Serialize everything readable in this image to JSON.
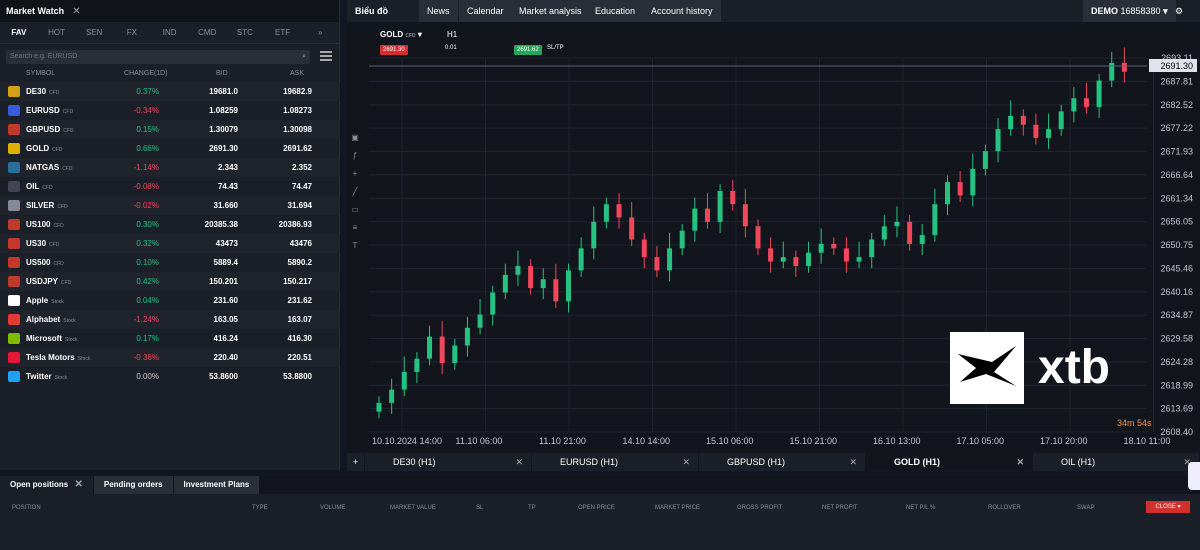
{
  "market_watch": {
    "title": "Market Watch",
    "categories": [
      "FAV",
      "HOT",
      "SEN",
      "FX",
      "IND",
      "CMD",
      "STC",
      "ETF",
      "»"
    ],
    "search_placeholder": "Search e.g. EURUSD",
    "columns": [
      "SYMBOL",
      "CHANGE(1D)",
      "BID",
      "ASK"
    ],
    "rows": [
      {
        "symbol": "DE30",
        "type": "CFD",
        "change": "0.37%",
        "bid": "19681.0",
        "ask": "19682.9",
        "dir": "pos",
        "icon": "flag-de-icon"
      },
      {
        "symbol": "EURUSD",
        "type": "CFD",
        "change": "-0.34%",
        "bid": "1.08259",
        "ask": "1.08273",
        "dir": "neg",
        "icon": "flag-eu-icon"
      },
      {
        "symbol": "GBPUSD",
        "type": "CFD",
        "change": "0.15%",
        "bid": "1.30079",
        "ask": "1.30098",
        "dir": "pos",
        "icon": "flag-gb-icon"
      },
      {
        "symbol": "GOLD",
        "type": "CFD",
        "change": "0.66%",
        "bid": "2691.30",
        "ask": "2691.62",
        "dir": "pos",
        "icon": "gold-icon"
      },
      {
        "symbol": "NATGAS",
        "type": "CFD",
        "change": "-1.14%",
        "bid": "2.343",
        "ask": "2.352",
        "dir": "neg",
        "icon": "flame-icon"
      },
      {
        "symbol": "OIL",
        "type": "CFD",
        "change": "-0.08%",
        "bid": "74.43",
        "ask": "74.47",
        "dir": "neg",
        "icon": "oil-icon"
      },
      {
        "symbol": "SILVER",
        "type": "CFD",
        "change": "-0.02%",
        "bid": "31.660",
        "ask": "31.694",
        "dir": "neg",
        "icon": "silver-icon"
      },
      {
        "symbol": "US100",
        "type": "CFD",
        "change": "0.30%",
        "bid": "20385.38",
        "ask": "20386.93",
        "dir": "pos",
        "icon": "flag-us-icon"
      },
      {
        "symbol": "US30",
        "type": "CFD",
        "change": "0.32%",
        "bid": "43473",
        "ask": "43476",
        "dir": "pos",
        "icon": "flag-us-icon"
      },
      {
        "symbol": "US500",
        "type": "CFD",
        "change": "0.10%",
        "bid": "5889.4",
        "ask": "5890.2",
        "dir": "pos",
        "icon": "flag-us-icon"
      },
      {
        "symbol": "USDJPY",
        "type": "CFD",
        "change": "0.42%",
        "bid": "150.201",
        "ask": "150.217",
        "dir": "pos",
        "icon": "flag-us-icon"
      },
      {
        "symbol": "Apple",
        "type": "Stock",
        "change": "0.04%",
        "bid": "231.60",
        "ask": "231.62",
        "dir": "pos",
        "icon": "apple-icon"
      },
      {
        "symbol": "Alphabet",
        "type": "Stock",
        "change": "-1.24%",
        "bid": "163.05",
        "ask": "163.07",
        "dir": "neg",
        "icon": "alphabet-icon"
      },
      {
        "symbol": "Microsoft",
        "type": "Stock",
        "change": "0.17%",
        "bid": "416.24",
        "ask": "416.30",
        "dir": "pos",
        "icon": "microsoft-icon"
      },
      {
        "symbol": "Tesla Motors",
        "type": "Stock",
        "change": "-0.36%",
        "bid": "220.40",
        "ask": "220.51",
        "dir": "neg",
        "icon": "tesla-icon"
      },
      {
        "symbol": "Twitter",
        "type": "Stock",
        "change": "0.00%",
        "bid": "53.8600",
        "ask": "53.8800",
        "dir": "neu",
        "icon": "twitter-icon"
      }
    ]
  },
  "top_tabs": [
    "Biểu đồ",
    "News",
    "Calendar",
    "Market analysis",
    "Education",
    "Account history"
  ],
  "account": {
    "label": "DEMO",
    "number": "16858380"
  },
  "chart_toolbar": {
    "symbol": "GOLD",
    "symbol_type": "CFD",
    "timeframe": "H1",
    "sell": "2691.30",
    "qty": "0.01",
    "buy": "2691.62",
    "sltp": "SL/TP"
  },
  "chart_tabs": [
    "DE30 (H1)",
    "EURUSD (H1)",
    "GBPUSD (H1)",
    "GOLD (H1)",
    "OIL (H1)"
  ],
  "active_chart_tab": "GOLD (H1)",
  "timer": "34m 54s",
  "logo": "xtb",
  "positions_tabs": [
    "Open positions",
    "Pending orders",
    "Investment Plans"
  ],
  "positions_columns": [
    "POSITION",
    "TYPE",
    "VOLUME",
    "MARKET VALUE",
    "SL",
    "TP",
    "OPEN PRICE",
    "MARKET PRICE",
    "GROSS PROFIT",
    "NET PROFIT",
    "NET P/L %",
    "ROLLOVER",
    "SWAP"
  ],
  "close_label": "CLOSE",
  "colors": {
    "up": "#26c281",
    "down": "#f0475b"
  },
  "chart_data": {
    "type": "candlestick",
    "title": "GOLD (H1)",
    "x_labels": [
      "10.10.2024 14:00",
      "11.10 06:00",
      "11.10 21:00",
      "14.10 14:00",
      "15.10 06:00",
      "15.10 21:00",
      "16.10 13:00",
      "17.10 05:00",
      "17.10 20:00",
      "18.10 11:00"
    ],
    "y_ticks": [
      "2693.11",
      "2687.81",
      "2682.52",
      "2677.22",
      "2671.93",
      "2666.64",
      "2661.34",
      "2656.05",
      "2650.75",
      "2645.46",
      "2640.16",
      "2634.87",
      "2629.58",
      "2624.28",
      "2618.99",
      "2613.69",
      "2608.40"
    ],
    "ylim": [
      2608.4,
      2693.11
    ],
    "current_price": "2691.30",
    "closes": [
      2615,
      2618,
      2622,
      2625,
      2630,
      2624,
      2628,
      2632,
      2635,
      2640,
      2644,
      2646,
      2641,
      2643,
      2638,
      2645,
      2650,
      2656,
      2660,
      2657,
      2652,
      2648,
      2645,
      2650,
      2654,
      2659,
      2656,
      2663,
      2660,
      2655,
      2650,
      2647,
      2648,
      2646,
      2649,
      2651,
      2650,
      2647,
      2648,
      2652,
      2655,
      2656,
      2651,
      2653,
      2660,
      2665,
      2662,
      2668,
      2672,
      2677,
      2680,
      2678,
      2675,
      2677,
      2681,
      2684,
      2682,
      2688,
      2692,
      2690
    ]
  }
}
